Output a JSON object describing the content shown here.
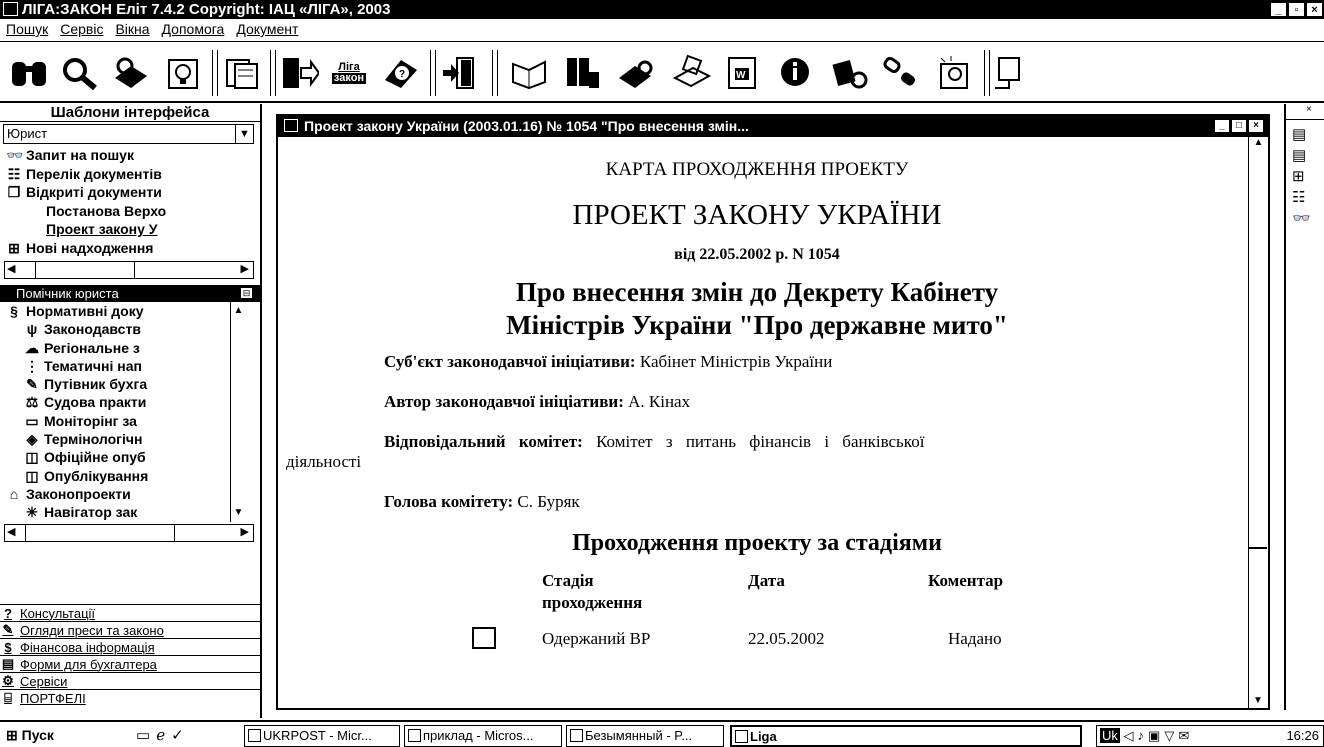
{
  "app": {
    "title": "ЛІГА:ЗАКОН Еліт 7.4.2 Copyright: ІАЦ «ЛІГА», 2003"
  },
  "menu": [
    "Пошук",
    "Сервіс",
    "Вікна",
    "Допомога",
    "Документ"
  ],
  "toolbar": {
    "liga_label_top": "Ліга",
    "liga_label_bottom": "закон"
  },
  "left": {
    "panel_title": "Шаблони інтерфейса",
    "template_value": "Юрист",
    "tree": [
      "Запит на пошук",
      "Перелік документів",
      "Відкриті документи",
      "Постанова Верхо",
      "Проект закону У",
      "Нові надходження"
    ],
    "assistant_title": "Помічник юриста",
    "tree2": [
      "Нормативні доку",
      "Законодавств",
      "Регіональне з",
      "Тематичні нап",
      "Путівник бухга",
      "Судова практи",
      "Моніторінг за",
      "Термінологічн",
      "Офіційне опуб",
      "Опублікування",
      "Законопроекти",
      "Навігатор зак"
    ],
    "links": [
      "Консультації",
      "Огляди преси та законо",
      "Фінансова інформація",
      "Форми для бухгалтера",
      "Сервіси",
      "ПОРТФЕЛІ"
    ]
  },
  "doc": {
    "window_title": "Проект закону України (2003.01.16) № 1054 \"Про внесення змін...",
    "card_title": "КАРТА ПРОХОДЖЕННЯ ПРОЕКТУ",
    "law_title": "ПРОЕКТ ЗАКОНУ УКРАЇНИ",
    "date_line": "від 22.05.2002 р. N 1054",
    "subject_line1": "Про внесення змін до Декрету Кабінету",
    "subject_line2": "Міністрів України \"Про державне мито\"",
    "initiator_label": "Суб'єкт законодавчої ініціативи:",
    "initiator_value": "Кабінет Міністрів України",
    "author_label": "Автор законодавчої ініціативи:",
    "author_value": "А. Кінах",
    "committee_label": "Відповідальний комітет:",
    "committee_value_1": "Комітет з питань фінансів і банківської",
    "committee_value_2": "діяльності",
    "head_label": "Голова комітету:",
    "head_value": "С. Буряк",
    "stages_title": "Проходження проекту за стадіями",
    "table_headers": [
      "Стадія",
      "Дата",
      "Коментар"
    ],
    "table_header_stage_2": "проходження",
    "row": {
      "stage": "Одержаний ВР",
      "date": "22.05.2002",
      "comment": "Надано"
    }
  },
  "taskbar": {
    "start": "Пуск",
    "tasks": [
      "UKRPOST - Micr...",
      "приклад - Micros...",
      "Безымянный - P...",
      "Liga"
    ],
    "lang": "Uk",
    "clock": "16:26"
  }
}
